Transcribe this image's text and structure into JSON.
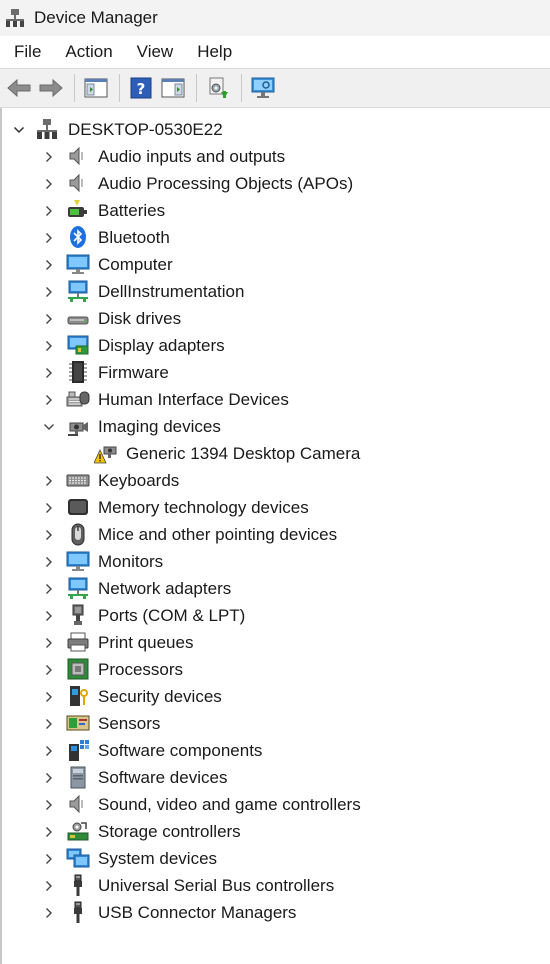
{
  "window": {
    "title": "Device Manager"
  },
  "menu": [
    "File",
    "Action",
    "View",
    "Help"
  ],
  "tree": {
    "root": "DESKTOP-0530E22",
    "categories": [
      {
        "label": "Audio inputs and outputs",
        "icon": "speaker-icon",
        "expanded": false
      },
      {
        "label": "Audio Processing Objects (APOs)",
        "icon": "speaker-icon",
        "expanded": false
      },
      {
        "label": "Batteries",
        "icon": "battery-icon",
        "expanded": false
      },
      {
        "label": "Bluetooth",
        "icon": "bluetooth-icon",
        "expanded": false
      },
      {
        "label": "Computer",
        "icon": "computer-icon",
        "expanded": false
      },
      {
        "label": "DellInstrumentation",
        "icon": "network-monitor-icon",
        "expanded": false
      },
      {
        "label": "Disk drives",
        "icon": "disk-drive-icon",
        "expanded": false
      },
      {
        "label": "Display adapters",
        "icon": "display-adapter-icon",
        "expanded": false
      },
      {
        "label": "Firmware",
        "icon": "chip-icon",
        "expanded": false
      },
      {
        "label": "Human Interface Devices",
        "icon": "hid-icon",
        "expanded": false
      },
      {
        "label": "Imaging devices",
        "icon": "camera-icon",
        "expanded": true,
        "children": [
          {
            "label": "Generic 1394 Desktop Camera",
            "icon": "camera-warning-icon"
          }
        ]
      },
      {
        "label": "Keyboards",
        "icon": "keyboard-icon",
        "expanded": false
      },
      {
        "label": "Memory technology devices",
        "icon": "memory-icon",
        "expanded": false
      },
      {
        "label": "Mice and other pointing devices",
        "icon": "mouse-icon",
        "expanded": false
      },
      {
        "label": "Monitors",
        "icon": "monitor-icon",
        "expanded": false
      },
      {
        "label": "Network adapters",
        "icon": "network-monitor-icon",
        "expanded": false
      },
      {
        "label": "Ports (COM & LPT)",
        "icon": "port-icon",
        "expanded": false
      },
      {
        "label": "Print queues",
        "icon": "printer-icon",
        "expanded": false
      },
      {
        "label": "Processors",
        "icon": "processor-icon",
        "expanded": false
      },
      {
        "label": "Security devices",
        "icon": "security-key-icon",
        "expanded": false
      },
      {
        "label": "Sensors",
        "icon": "sensor-icon",
        "expanded": false
      },
      {
        "label": "Software components",
        "icon": "software-component-icon",
        "expanded": false
      },
      {
        "label": "Software devices",
        "icon": "software-device-icon",
        "expanded": false
      },
      {
        "label": "Sound, video and game controllers",
        "icon": "speaker-icon",
        "expanded": false
      },
      {
        "label": "Storage controllers",
        "icon": "storage-controller-icon",
        "expanded": false
      },
      {
        "label": "System devices",
        "icon": "system-device-icon",
        "expanded": false
      },
      {
        "label": "Universal Serial Bus controllers",
        "icon": "usb-icon",
        "expanded": false
      },
      {
        "label": "USB Connector Managers",
        "icon": "usb-icon",
        "expanded": false
      }
    ]
  }
}
